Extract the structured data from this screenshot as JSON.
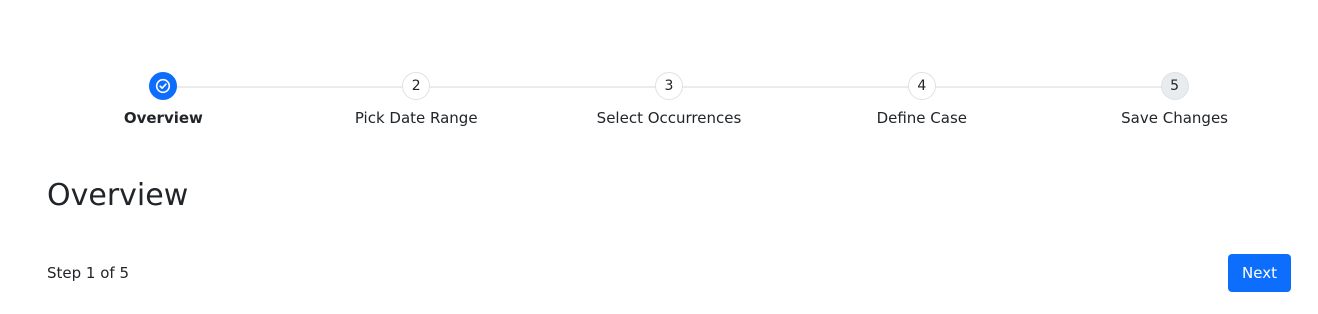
{
  "stepper": {
    "steps": [
      {
        "number": "1",
        "label": "Overview",
        "state": "active",
        "icon": "check-circle-icon"
      },
      {
        "number": "2",
        "label": "Pick Date Range",
        "state": "upcoming"
      },
      {
        "number": "3",
        "label": "Select Occurrences",
        "state": "upcoming"
      },
      {
        "number": "4",
        "label": "Define Case",
        "state": "upcoming"
      },
      {
        "number": "5",
        "label": "Save Changes",
        "state": "upcoming"
      }
    ]
  },
  "main": {
    "title": "Overview"
  },
  "footer": {
    "step_counter": "Step 1 of 5",
    "next_label": "Next"
  },
  "colors": {
    "accent": "#0d6efd",
    "track": "#e9ecef",
    "marker_border": "#dee2e6",
    "text": "#212529"
  }
}
